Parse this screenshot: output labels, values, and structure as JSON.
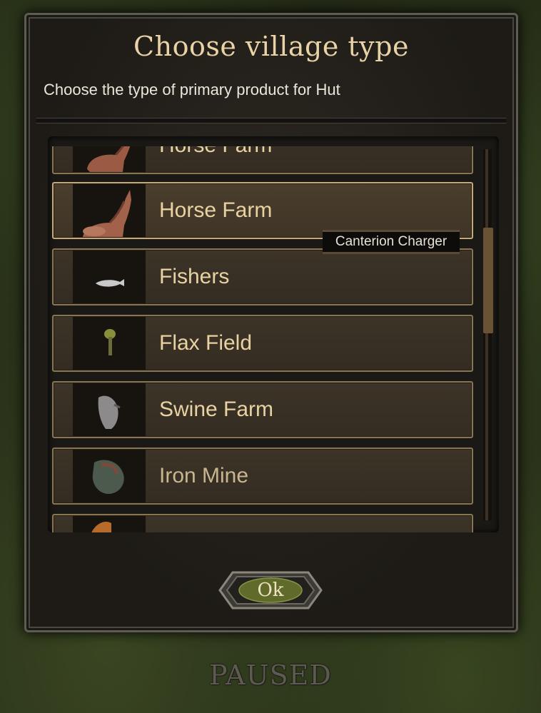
{
  "dialog": {
    "title": "Choose village type",
    "subtitle": "Choose the type of primary product for Hut"
  },
  "list": {
    "items": [
      {
        "label": "Horse Farm",
        "icon": "horse-icon",
        "state": "partially-visible-top"
      },
      {
        "label": "Horse Farm",
        "icon": "horse-icon",
        "state": "selected"
      },
      {
        "label": "Fishers",
        "icon": "fish-icon",
        "state": "normal"
      },
      {
        "label": "Flax Field",
        "icon": "flax-icon",
        "state": "normal"
      },
      {
        "label": "Swine Farm",
        "icon": "pig-icon",
        "state": "normal"
      },
      {
        "label": "Iron Mine",
        "icon": "iron-ore-icon",
        "state": "normal"
      },
      {
        "label": "",
        "icon": "clay-icon",
        "state": "partially-visible-bottom"
      }
    ],
    "scroll_position": 0.3
  },
  "tooltip": {
    "text": "Canterion Charger"
  },
  "ok_button": {
    "label": "Ok"
  },
  "status": {
    "paused": "PAUSED"
  },
  "colors": {
    "title": "#e9d3a6",
    "row_label": "#e9d2a2",
    "row_border": "#8a7552",
    "row_border_selected": "#c7a877",
    "ok_button": "#5f6a2b"
  }
}
